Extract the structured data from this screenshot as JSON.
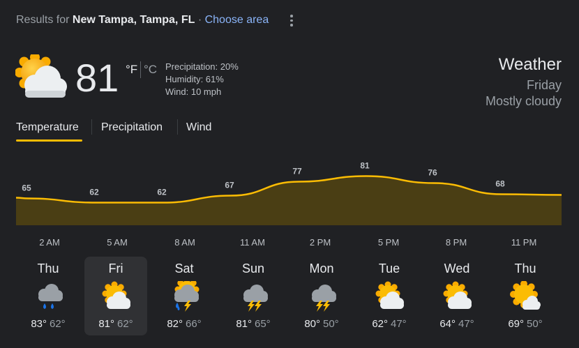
{
  "header": {
    "results_prefix": "Results for",
    "location": "New Tampa, Tampa, FL",
    "separator": "·",
    "choose_area": "Choose area"
  },
  "current": {
    "icon": "partly-cloudy-icon",
    "temperature": "81",
    "unit_f": "°F",
    "unit_c": "°C",
    "precipitation": "Precipitation: 20%",
    "humidity": "Humidity: 61%",
    "wind": "Wind: 10 mph"
  },
  "summary": {
    "title": "Weather",
    "day": "Friday",
    "condition": "Mostly cloudy"
  },
  "tabs": [
    {
      "label": "Temperature",
      "active": true
    },
    {
      "label": "Precipitation",
      "active": false
    },
    {
      "label": "Wind",
      "active": false
    }
  ],
  "chart_data": {
    "type": "area",
    "x": [
      "2 AM",
      "5 AM",
      "8 AM",
      "11 AM",
      "2 PM",
      "5 PM",
      "8 PM",
      "11 PM"
    ],
    "values": [
      65,
      62,
      62,
      67,
      77,
      81,
      76,
      68
    ],
    "value_labels": [
      "65",
      "62",
      "62",
      "67",
      "77",
      "81",
      "76",
      "68"
    ],
    "line_color": "#fbbc04",
    "fill_color": "#4a3e14",
    "grid": false,
    "legend": "none"
  },
  "days": [
    {
      "name": "Thu",
      "icon": "rain-icon",
      "high": "83°",
      "low": "62°",
      "selected": false
    },
    {
      "name": "Fri",
      "icon": "partly-cloudy-icon",
      "high": "81°",
      "low": "62°",
      "selected": true
    },
    {
      "name": "Sat",
      "icon": "thunderstorm-sun-rain-icon",
      "high": "82°",
      "low": "66°",
      "selected": false
    },
    {
      "name": "Sun",
      "icon": "thunderstorm-icon",
      "high": "81°",
      "low": "65°",
      "selected": false
    },
    {
      "name": "Mon",
      "icon": "thunderstorm-icon",
      "high": "80°",
      "low": "50°",
      "selected": false
    },
    {
      "name": "Tue",
      "icon": "partly-cloudy-icon",
      "high": "62°",
      "low": "47°",
      "selected": false
    },
    {
      "name": "Wed",
      "icon": "partly-cloudy-icon",
      "high": "64°",
      "low": "47°",
      "selected": false
    },
    {
      "name": "Thu",
      "icon": "mostly-sunny-icon",
      "high": "69°",
      "low": "50°",
      "selected": false
    }
  ],
  "colors": {
    "accent": "#fbbc04",
    "link": "#8ab4f8",
    "background": "#202124"
  }
}
